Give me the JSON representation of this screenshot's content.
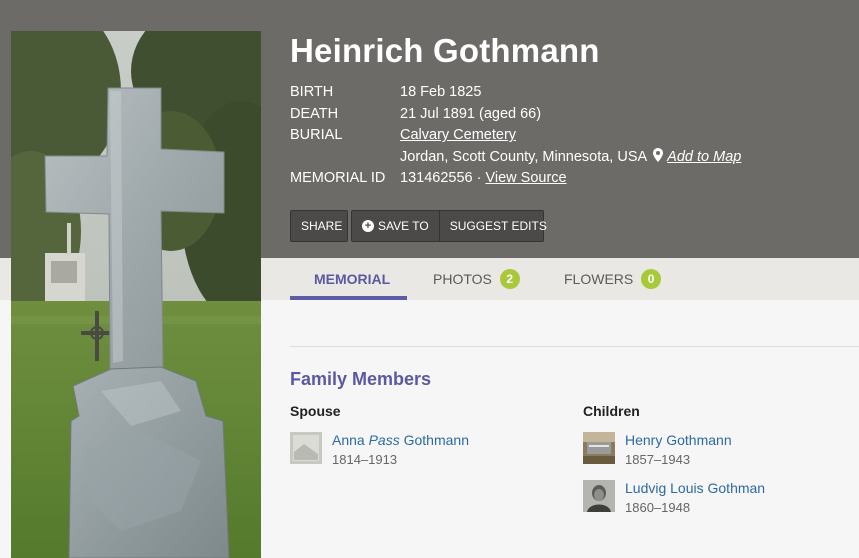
{
  "memorial": {
    "name": "Heinrich Gothmann",
    "birth_label": "BIRTH",
    "birth_value": "18 Feb 1825",
    "death_label": "DEATH",
    "death_value": "21 Jul 1891 (aged 66)",
    "burial_label": "BURIAL",
    "burial_cemetery": "Calvary Cemetery",
    "burial_location": "Jordan, Scott County, Minnesota, USA",
    "add_to_map": "Add to Map",
    "memorial_id_label": "MEMORIAL ID",
    "memorial_id_value": "131462556 ·",
    "view_source": "View Source"
  },
  "actions": {
    "share": "SHARE",
    "save_to": "SAVE TO",
    "suggest_edits": "SUGGEST EDITS"
  },
  "tabs": [
    {
      "label": "MEMORIAL",
      "active": true
    },
    {
      "label": "PHOTOS",
      "badge": "2"
    },
    {
      "label": "FLOWERS",
      "badge": "0"
    }
  ],
  "family": {
    "title": "Family Members",
    "spouse_heading": "Spouse",
    "children_heading": "Children",
    "spouse": [
      {
        "first": "Anna",
        "maiden": "Pass",
        "last": "Gothmann",
        "dates": "1814–1913"
      }
    ],
    "children": [
      {
        "name": "Henry Gothmann",
        "dates": "1857–1943"
      },
      {
        "name": "Ludvig Louis Gothman",
        "dates": "1860–1948"
      }
    ]
  },
  "colors": {
    "header_bg": "#6d6b68",
    "accent_purple": "#5b5aa0",
    "link_blue": "#2c6aa0",
    "badge_green": "#a8c93a"
  }
}
